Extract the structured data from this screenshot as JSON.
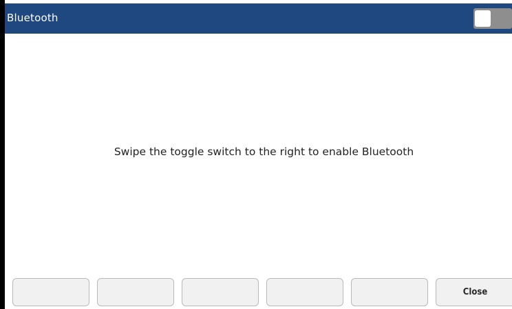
{
  "title_bar": {
    "title": "Bluetooth",
    "toggle": {
      "state": "off"
    }
  },
  "content": {
    "message": "Swipe the toggle switch to the right to enable Bluetooth"
  },
  "soft_keys": [
    {
      "label": ""
    },
    {
      "label": ""
    },
    {
      "label": ""
    },
    {
      "label": ""
    },
    {
      "label": ""
    },
    {
      "label": "Close"
    }
  ],
  "colors": {
    "title_bar_bg": "#1f4780",
    "title_text": "#ffffff",
    "toggle_off_track": "#8e8e8e",
    "soft_key_bg": "#f1f1f1",
    "soft_key_border": "#b9b9b9"
  }
}
